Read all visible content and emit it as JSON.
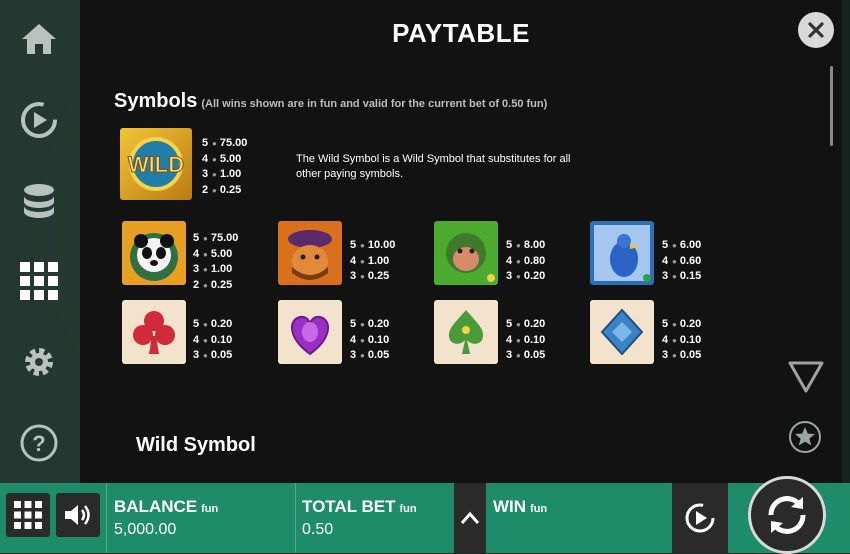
{
  "title": "PAYTABLE",
  "section": {
    "title": "Symbols",
    "note": "(All wins shown are in fun and valid for the current bet of 0.50 fun)"
  },
  "wild": {
    "icon": "wild-symbol",
    "icon_text": "WILD",
    "payouts": [
      {
        "count": "5",
        "value": "75.00"
      },
      {
        "count": "4",
        "value": "5.00"
      },
      {
        "count": "3",
        "value": "1.00"
      },
      {
        "count": "2",
        "value": "0.25"
      }
    ],
    "description": "The Wild Symbol is a Wild Symbol that substitutes for all other paying symbols."
  },
  "symbols_row1": [
    {
      "icon": "panda-symbol",
      "payouts": [
        {
          "count": "5",
          "value": "75.00"
        },
        {
          "count": "4",
          "value": "5.00"
        },
        {
          "count": "3",
          "value": "1.00"
        },
        {
          "count": "2",
          "value": "0.25"
        }
      ]
    },
    {
      "icon": "warrior-symbol",
      "payouts": [
        {
          "count": "5",
          "value": "10.00"
        },
        {
          "count": "4",
          "value": "1.00"
        },
        {
          "count": "3",
          "value": "0.25"
        }
      ]
    },
    {
      "icon": "monkey-symbol",
      "payouts": [
        {
          "count": "5",
          "value": "8.00"
        },
        {
          "count": "4",
          "value": "0.80"
        },
        {
          "count": "3",
          "value": "0.20"
        }
      ]
    },
    {
      "icon": "bird-symbol",
      "payouts": [
        {
          "count": "5",
          "value": "6.00"
        },
        {
          "count": "4",
          "value": "0.60"
        },
        {
          "count": "3",
          "value": "0.15"
        }
      ]
    }
  ],
  "symbols_row2": [
    {
      "icon": "club-symbol",
      "payouts": [
        {
          "count": "5",
          "value": "0.20"
        },
        {
          "count": "4",
          "value": "0.10"
        },
        {
          "count": "3",
          "value": "0.05"
        }
      ]
    },
    {
      "icon": "heart-symbol",
      "payouts": [
        {
          "count": "5",
          "value": "0.20"
        },
        {
          "count": "4",
          "value": "0.10"
        },
        {
          "count": "3",
          "value": "0.05"
        }
      ]
    },
    {
      "icon": "spade-symbol",
      "payouts": [
        {
          "count": "5",
          "value": "0.20"
        },
        {
          "count": "4",
          "value": "0.10"
        },
        {
          "count": "3",
          "value": "0.05"
        }
      ]
    },
    {
      "icon": "diamond-symbol",
      "payouts": [
        {
          "count": "5",
          "value": "0.20"
        },
        {
          "count": "4",
          "value": "0.10"
        },
        {
          "count": "3",
          "value": "0.05"
        }
      ]
    }
  ],
  "subheading": "Wild Symbol",
  "bottombar": {
    "balance_label": "BALANCE",
    "balance_unit": "fun",
    "balance_value": "5,000.00",
    "bet_label": "TOTAL BET",
    "bet_unit": "fun",
    "bet_value": "0.50",
    "win_label": "WIN",
    "win_unit": "fun"
  },
  "colors": {
    "accent": "#1f8c69",
    "panel": "#121212",
    "sidebar": "#283c34"
  }
}
